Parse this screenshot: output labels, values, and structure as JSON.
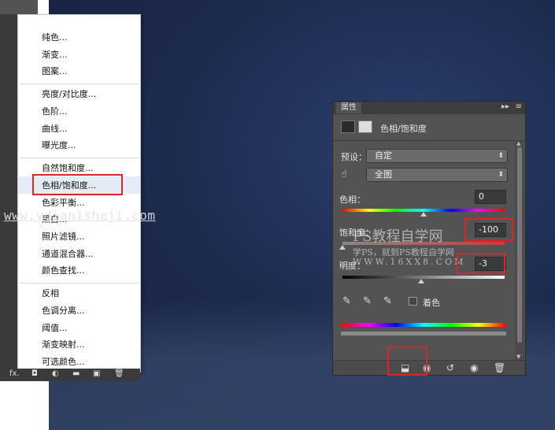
{
  "colors": {
    "accent_red": "#d8262b",
    "panel_bg": "#535353",
    "menu_bg": "#ffffff",
    "sky": "#1d2b4f"
  },
  "adjust_menu": {
    "items": [
      "纯色...",
      "渐变...",
      "图案...",
      "亮度/对比度...",
      "色阶...",
      "曲线...",
      "曝光度...",
      "自然饱和度...",
      "色相/饱和度...",
      "色彩平衡...",
      "黑白...",
      "照片滤镜...",
      "通道混合器...",
      "颜色查找...",
      "反相",
      "色调分离...",
      "阈值...",
      "渐变映射...",
      "可选颜色..."
    ],
    "selected": "色相/饱和度..."
  },
  "layers_toolbar": {
    "fx_label": "fx."
  },
  "watermark": {
    "url": "www.ydianisheji.com",
    "cn": "PS教程自学网",
    "cn_sub": "学PS，就到PS教程自学网",
    "site": "WWW.16XX8.COM"
  },
  "properties": {
    "tab": "属性",
    "title": "色相/饱和度",
    "preset_label": "预设：",
    "preset_value": "自定",
    "channel_value": "全图",
    "hue_label": "色相：",
    "hue_value": "0",
    "saturation_label": "饱和度：",
    "saturation_value": "-100",
    "lightness_label": "明度：",
    "lightness_value": "-3",
    "colorize_label": "着色",
    "hue_norm": 0.5,
    "saturation_norm": 0.0,
    "lightness_norm": 0.485
  },
  "icons": {
    "eyedropper": "eyedropper-icon",
    "hand": "hand-icon",
    "trash": "trash-icon",
    "eye": "eye-icon",
    "reset": "reset-icon",
    "clip": "clip-icon"
  }
}
